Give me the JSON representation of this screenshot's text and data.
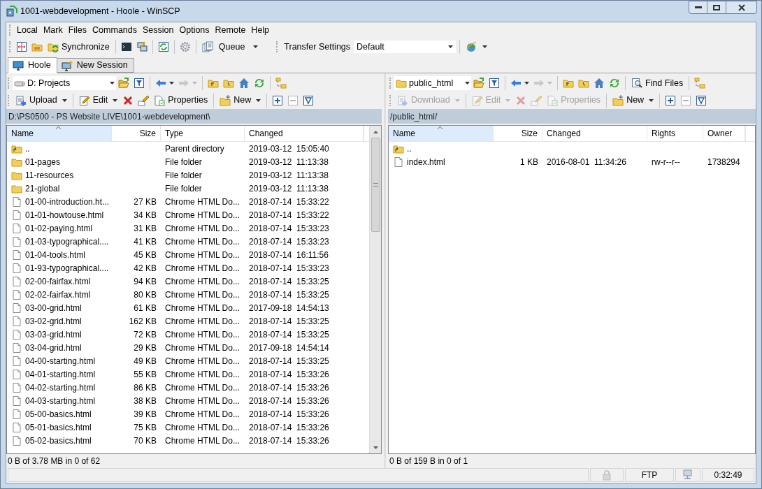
{
  "window": {
    "title": "1001-webdevelopment - Hoole - WinSCP"
  },
  "menu": [
    "Local",
    "Mark",
    "Files",
    "Commands",
    "Session",
    "Options",
    "Remote",
    "Help"
  ],
  "toolbar": {
    "synchronize": "Synchronize",
    "queue": "Queue",
    "transfer_settings_label": "Transfer Settings",
    "transfer_settings_value": "Default"
  },
  "session_tabs": [
    {
      "label": "Hoole",
      "selected": true
    },
    {
      "label": "New Session",
      "selected": false
    }
  ],
  "local": {
    "location": "D: Projects",
    "actions": [
      {
        "kind": "upload",
        "label": "Upload",
        "disabled": false
      },
      {
        "kind": "edit",
        "label": "Edit",
        "disabled": false
      },
      {
        "kind": "properties",
        "label": "Properties",
        "disabled": false
      },
      {
        "kind": "new",
        "label": "New",
        "disabled": false
      }
    ],
    "path": "D:\\PS0500 - PS Website LIVE\\1001-webdevelopment\\",
    "columns": [
      {
        "label": "Name",
        "sorted": true
      },
      {
        "label": "Size",
        "sorted": false
      },
      {
        "label": "Type",
        "sorted": false
      },
      {
        "label": "Changed",
        "sorted": false
      }
    ],
    "rows": [
      {
        "kind": "parent",
        "name": "..",
        "type": "Parent directory",
        "changed": "2019-03-12  15:05:40"
      },
      {
        "kind": "folder",
        "name": "01-pages",
        "type": "File folder",
        "changed": "2019-03-12  11:13:38"
      },
      {
        "kind": "folder",
        "name": "11-resources",
        "type": "File folder",
        "changed": "2019-03-12  11:13:38"
      },
      {
        "kind": "folder",
        "name": "21-global",
        "type": "File folder",
        "changed": "2019-03-12  11:13:38"
      },
      {
        "kind": "file",
        "name": "01-00-introduction.ht...",
        "size": "27 KB",
        "type": "Chrome HTML Do...",
        "changed": "2018-07-14  15:33:22"
      },
      {
        "kind": "file",
        "name": "01-01-howtouse.html",
        "size": "34 KB",
        "type": "Chrome HTML Do...",
        "changed": "2018-07-14  15:33:22"
      },
      {
        "kind": "file",
        "name": "01-02-paying.html",
        "size": "31 KB",
        "type": "Chrome HTML Do...",
        "changed": "2018-07-14  15:33:23"
      },
      {
        "kind": "file",
        "name": "01-03-typographical....",
        "size": "41 KB",
        "type": "Chrome HTML Do...",
        "changed": "2018-07-14  15:33:23"
      },
      {
        "kind": "file",
        "name": "01-04-tools.html",
        "size": "45 KB",
        "type": "Chrome HTML Do...",
        "changed": "2018-07-14  16:11:56"
      },
      {
        "kind": "file",
        "name": "01-93-typographical....",
        "size": "42 KB",
        "type": "Chrome HTML Do...",
        "changed": "2018-07-14  15:33:23"
      },
      {
        "kind": "file",
        "name": "02-00-fairfax.html",
        "size": "94 KB",
        "type": "Chrome HTML Do...",
        "changed": "2018-07-14  15:33:25"
      },
      {
        "kind": "file",
        "name": "02-02-fairfax.html",
        "size": "80 KB",
        "type": "Chrome HTML Do...",
        "changed": "2018-07-14  15:33:25"
      },
      {
        "kind": "file",
        "name": "03-00-grid.html",
        "size": "61 KB",
        "type": "Chrome HTML Do...",
        "changed": "2017-09-18  14:54:13"
      },
      {
        "kind": "file",
        "name": "03-02-grid.html",
        "size": "162 KB",
        "type": "Chrome HTML Do...",
        "changed": "2018-07-14  15:33:25"
      },
      {
        "kind": "file",
        "name": "03-03-grid.html",
        "size": "72 KB",
        "type": "Chrome HTML Do...",
        "changed": "2018-07-14  15:33:25"
      },
      {
        "kind": "file",
        "name": "03-04-grid.html",
        "size": "29 KB",
        "type": "Chrome HTML Do...",
        "changed": "2017-09-18  14:54:14"
      },
      {
        "kind": "file",
        "name": "04-00-starting.html",
        "size": "49 KB",
        "type": "Chrome HTML Do...",
        "changed": "2018-07-14  15:33:25"
      },
      {
        "kind": "file",
        "name": "04-01-starting.html",
        "size": "55 KB",
        "type": "Chrome HTML Do...",
        "changed": "2018-07-14  15:33:26"
      },
      {
        "kind": "file",
        "name": "04-02-starting.html",
        "size": "86 KB",
        "type": "Chrome HTML Do...",
        "changed": "2018-07-14  15:33:26"
      },
      {
        "kind": "file",
        "name": "04-03-starting.html",
        "size": "38 KB",
        "type": "Chrome HTML Do...",
        "changed": "2018-07-14  15:33:26"
      },
      {
        "kind": "file",
        "name": "05-00-basics.html",
        "size": "39 KB",
        "type": "Chrome HTML Do...",
        "changed": "2018-07-14  15:33:26"
      },
      {
        "kind": "file",
        "name": "05-01-basics.html",
        "size": "75 KB",
        "type": "Chrome HTML Do...",
        "changed": "2018-07-14  15:33:26"
      },
      {
        "kind": "file",
        "name": "05-02-basics.html",
        "size": "70 KB",
        "type": "Chrome HTML Do...",
        "changed": "2018-07-14  15:33:26"
      }
    ],
    "summary": "0 B of 3.78 MB in 0 of 62"
  },
  "remote": {
    "location": "public_html",
    "find_files": "Find Files",
    "actions": [
      {
        "kind": "download",
        "label": "Download",
        "disabled": true
      },
      {
        "kind": "edit",
        "label": "Edit",
        "disabled": true
      },
      {
        "kind": "properties",
        "label": "Properties",
        "disabled": true
      },
      {
        "kind": "new",
        "label": "New",
        "disabled": false
      }
    ],
    "path": "/public_html/",
    "columns": [
      {
        "label": "Name",
        "sorted": true
      },
      {
        "label": "Size",
        "sorted": false
      },
      {
        "label": "Changed",
        "sorted": false
      },
      {
        "label": "Rights",
        "sorted": false
      },
      {
        "label": "Owner",
        "sorted": false
      }
    ],
    "rows": [
      {
        "kind": "parent",
        "name": ".."
      },
      {
        "kind": "file",
        "name": "index.html",
        "size": "1 KB",
        "changed": "2016-08-01  11:34:26",
        "rights": "rw-r--r--",
        "owner": "1738294"
      }
    ],
    "summary": "0 B of 159 B in 0 of 1"
  },
  "status_bar": {
    "protocol": "FTP",
    "time": "0:32:49"
  }
}
